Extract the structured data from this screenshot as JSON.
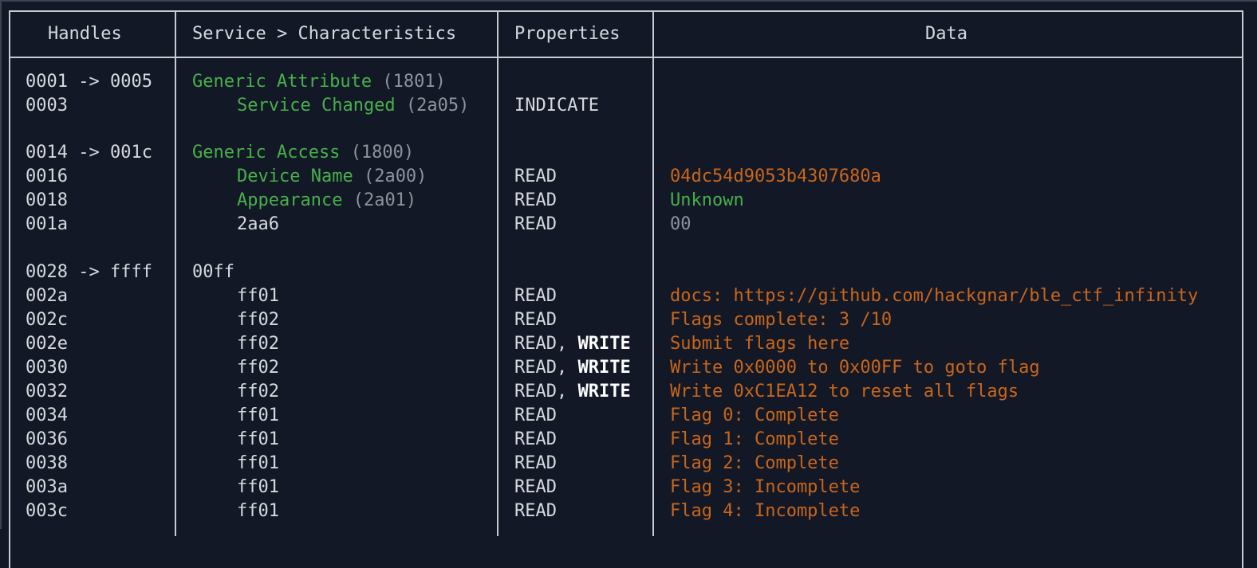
{
  "headers": {
    "handles": "Handles",
    "service": "Service > Characteristics",
    "properties": "Properties",
    "data": "Data"
  },
  "rows": [
    {
      "handle": "0001 -> 0005",
      "name": "Generic Attribute",
      "uuid": "(1801)",
      "props": "",
      "write": "",
      "data": "",
      "kind": "service"
    },
    {
      "handle": "0003",
      "name": "Service Changed",
      "uuid": "(2a05)",
      "props": "INDICATE",
      "write": "",
      "data": "",
      "kind": "char-named"
    },
    {
      "handle": "0014 -> 001c",
      "name": "Generic Access",
      "uuid": "(1800)",
      "props": "",
      "write": "",
      "data": "",
      "kind": "service"
    },
    {
      "handle": "0016",
      "name": "Device Name",
      "uuid": "(2a00)",
      "props": "READ",
      "write": "",
      "data": "04dc54d9053b4307680a",
      "kind": "char-named",
      "data_color": "orange"
    },
    {
      "handle": "0018",
      "name": "Appearance",
      "uuid": "(2a01)",
      "props": "READ",
      "write": "",
      "data": "Unknown",
      "kind": "char-named",
      "data_color": "green"
    },
    {
      "handle": "001a",
      "name": "2aa6",
      "uuid": "",
      "props": "READ",
      "write": "",
      "data": "00",
      "kind": "char-plain",
      "data_color": "dim"
    },
    {
      "handle": "0028 -> ffff",
      "name": "00ff",
      "uuid": "",
      "props": "",
      "write": "",
      "data": "",
      "kind": "service-plain"
    },
    {
      "handle": "002a",
      "name": "ff01",
      "uuid": "",
      "props": "READ",
      "write": "",
      "data": "docs: https://github.com/hackgnar/ble_ctf_infinity",
      "kind": "char-plain",
      "data_color": "orange"
    },
    {
      "handle": "002c",
      "name": "ff02",
      "uuid": "",
      "props": "READ",
      "write": "",
      "data": "Flags complete: 3 /10",
      "kind": "char-plain",
      "data_color": "orange"
    },
    {
      "handle": "002e",
      "name": "ff02",
      "uuid": "",
      "props": "READ, ",
      "write": "WRITE",
      "data": "Submit flags here",
      "kind": "char-plain",
      "data_color": "orange"
    },
    {
      "handle": "0030",
      "name": "ff02",
      "uuid": "",
      "props": "READ, ",
      "write": "WRITE",
      "data": "Write 0x0000 to 0x00FF to goto flag",
      "kind": "char-plain",
      "data_color": "orange"
    },
    {
      "handle": "0032",
      "name": "ff02",
      "uuid": "",
      "props": "READ, ",
      "write": "WRITE",
      "data": "Write 0xC1EA12 to reset all flags",
      "kind": "char-plain",
      "data_color": "orange"
    },
    {
      "handle": "0034",
      "name": "ff01",
      "uuid": "",
      "props": "READ",
      "write": "",
      "data": "Flag 0: Complete",
      "kind": "char-plain",
      "data_color": "orange"
    },
    {
      "handle": "0036",
      "name": "ff01",
      "uuid": "",
      "props": "READ",
      "write": "",
      "data": "Flag 1: Complete",
      "kind": "char-plain",
      "data_color": "orange"
    },
    {
      "handle": "0038",
      "name": "ff01",
      "uuid": "",
      "props": "READ",
      "write": "",
      "data": "Flag 2: Complete",
      "kind": "char-plain",
      "data_color": "orange"
    },
    {
      "handle": "003a",
      "name": "ff01",
      "uuid": "",
      "props": "READ",
      "write": "",
      "data": "Flag 3: Incomplete",
      "kind": "char-plain",
      "data_color": "orange"
    },
    {
      "handle": "003c",
      "name": "ff01",
      "uuid": "",
      "props": "READ",
      "write": "",
      "data": "Flag 4: Incomplete",
      "kind": "char-plain",
      "data_color": "orange"
    }
  ]
}
